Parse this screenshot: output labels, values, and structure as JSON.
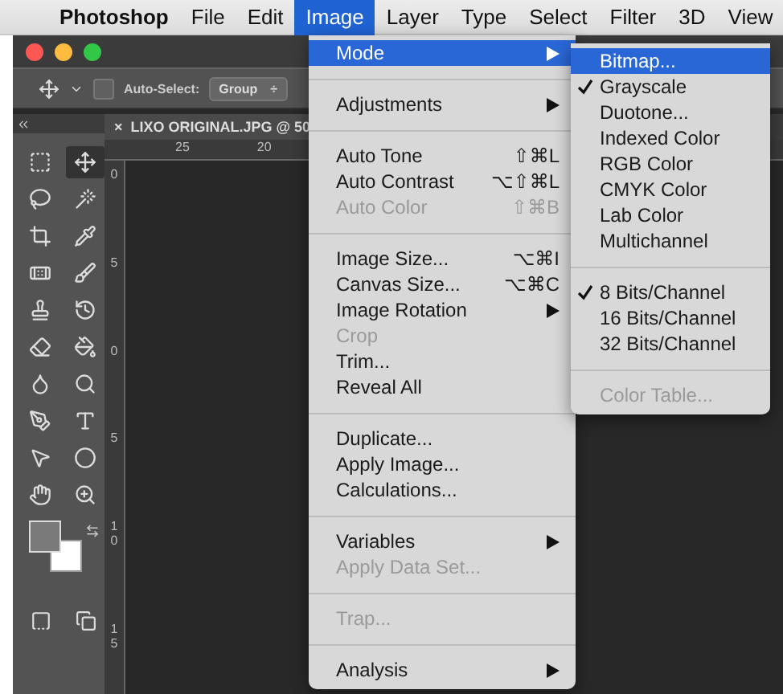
{
  "menubar": {
    "app": "Photoshop",
    "items": [
      {
        "label": "File",
        "selected": false
      },
      {
        "label": "Edit",
        "selected": false
      },
      {
        "label": "Image",
        "selected": true
      },
      {
        "label": "Layer",
        "selected": false
      },
      {
        "label": "Type",
        "selected": false
      },
      {
        "label": "Select",
        "selected": false
      },
      {
        "label": "Filter",
        "selected": false
      },
      {
        "label": "3D",
        "selected": false
      },
      {
        "label": "View",
        "selected": false
      }
    ]
  },
  "options_bar": {
    "auto_select_label": "Auto-Select:",
    "auto_select_checked": false,
    "dropdown": "Group",
    "dropdown_arrows": "÷"
  },
  "document_tab": {
    "close": "×",
    "title": "LIXO ORIGINAL.JPG @ 50"
  },
  "rulers": {
    "horizontal": [
      "25",
      "20"
    ],
    "vertical": [
      "0",
      "5",
      "0",
      "5",
      "10",
      "15"
    ]
  },
  "tools": [
    {
      "selected": false
    },
    {
      "selected": true
    },
    {
      "selected": false
    },
    {
      "selected": false
    },
    {
      "selected": false
    },
    {
      "selected": false
    },
    {
      "selected": false
    },
    {
      "selected": false
    },
    {
      "selected": false
    },
    {
      "selected": false
    },
    {
      "selected": false
    },
    {
      "selected": false
    },
    {
      "selected": false
    },
    {
      "selected": false
    },
    {
      "selected": false
    },
    {
      "selected": false
    },
    {
      "selected": false
    },
    {
      "selected": false
    },
    {
      "selected": false
    },
    {
      "selected": false
    }
  ],
  "image_menu": {
    "items": [
      {
        "kind": "item",
        "label": "Mode",
        "submenu": true,
        "disabled": false,
        "selected": true
      },
      {
        "kind": "separator"
      },
      {
        "kind": "item",
        "label": "Adjustments",
        "submenu": true,
        "disabled": false,
        "selected": false
      },
      {
        "kind": "separator"
      },
      {
        "kind": "item",
        "label": "Auto Tone",
        "shortcut": "⇧⌘L",
        "submenu": false,
        "disabled": false,
        "selected": false
      },
      {
        "kind": "item",
        "label": "Auto Contrast",
        "shortcut": "⌥⇧⌘L",
        "submenu": false,
        "disabled": false,
        "selected": false
      },
      {
        "kind": "item",
        "label": "Auto Color",
        "shortcut": "⇧⌘B",
        "submenu": false,
        "disabled": true,
        "selected": false
      },
      {
        "kind": "separator"
      },
      {
        "kind": "item",
        "label": "Image Size...",
        "shortcut": "⌥⌘I",
        "submenu": false,
        "disabled": false,
        "selected": false
      },
      {
        "kind": "item",
        "label": "Canvas Size...",
        "shortcut": "⌥⌘C",
        "submenu": false,
        "disabled": false,
        "selected": false
      },
      {
        "kind": "item",
        "label": "Image Rotation",
        "submenu": true,
        "disabled": false,
        "selected": false
      },
      {
        "kind": "item",
        "label": "Crop",
        "submenu": false,
        "disabled": true,
        "selected": false
      },
      {
        "kind": "item",
        "label": "Trim...",
        "submenu": false,
        "disabled": false,
        "selected": false
      },
      {
        "kind": "item",
        "label": "Reveal All",
        "submenu": false,
        "disabled": false,
        "selected": false
      },
      {
        "kind": "separator"
      },
      {
        "kind": "item",
        "label": "Duplicate...",
        "submenu": false,
        "disabled": false,
        "selected": false
      },
      {
        "kind": "item",
        "label": "Apply Image...",
        "submenu": false,
        "disabled": false,
        "selected": false
      },
      {
        "kind": "item",
        "label": "Calculations...",
        "submenu": false,
        "disabled": false,
        "selected": false
      },
      {
        "kind": "separator"
      },
      {
        "kind": "item",
        "label": "Variables",
        "submenu": true,
        "disabled": false,
        "selected": false
      },
      {
        "kind": "item",
        "label": "Apply Data Set...",
        "submenu": false,
        "disabled": true,
        "selected": false
      },
      {
        "kind": "separator"
      },
      {
        "kind": "item",
        "label": "Trap...",
        "submenu": false,
        "disabled": true,
        "selected": false
      },
      {
        "kind": "separator"
      },
      {
        "kind": "item",
        "label": "Analysis",
        "submenu": true,
        "disabled": false,
        "selected": false
      }
    ]
  },
  "mode_submenu": {
    "items": [
      {
        "kind": "item",
        "label": "Bitmap...",
        "checked": false,
        "disabled": false,
        "selected": true
      },
      {
        "kind": "item",
        "label": "Grayscale",
        "checked": true,
        "disabled": false,
        "selected": false
      },
      {
        "kind": "item",
        "label": "Duotone...",
        "checked": false,
        "disabled": false,
        "selected": false
      },
      {
        "kind": "item",
        "label": "Indexed Color",
        "checked": false,
        "disabled": false,
        "selected": false
      },
      {
        "kind": "item",
        "label": "RGB Color",
        "checked": false,
        "disabled": false,
        "selected": false
      },
      {
        "kind": "item",
        "label": "CMYK Color",
        "checked": false,
        "disabled": false,
        "selected": false
      },
      {
        "kind": "item",
        "label": "Lab Color",
        "checked": false,
        "disabled": false,
        "selected": false
      },
      {
        "kind": "item",
        "label": "Multichannel",
        "checked": false,
        "disabled": false,
        "selected": false
      },
      {
        "kind": "separator"
      },
      {
        "kind": "item",
        "label": "8 Bits/Channel",
        "checked": true,
        "disabled": false,
        "selected": false
      },
      {
        "kind": "item",
        "label": "16 Bits/Channel",
        "checked": false,
        "disabled": false,
        "selected": false
      },
      {
        "kind": "item",
        "label": "32 Bits/Channel",
        "checked": false,
        "disabled": false,
        "selected": false
      },
      {
        "kind": "separator"
      },
      {
        "kind": "item",
        "label": "Color Table...",
        "checked": false,
        "disabled": true,
        "selected": false
      }
    ]
  }
}
